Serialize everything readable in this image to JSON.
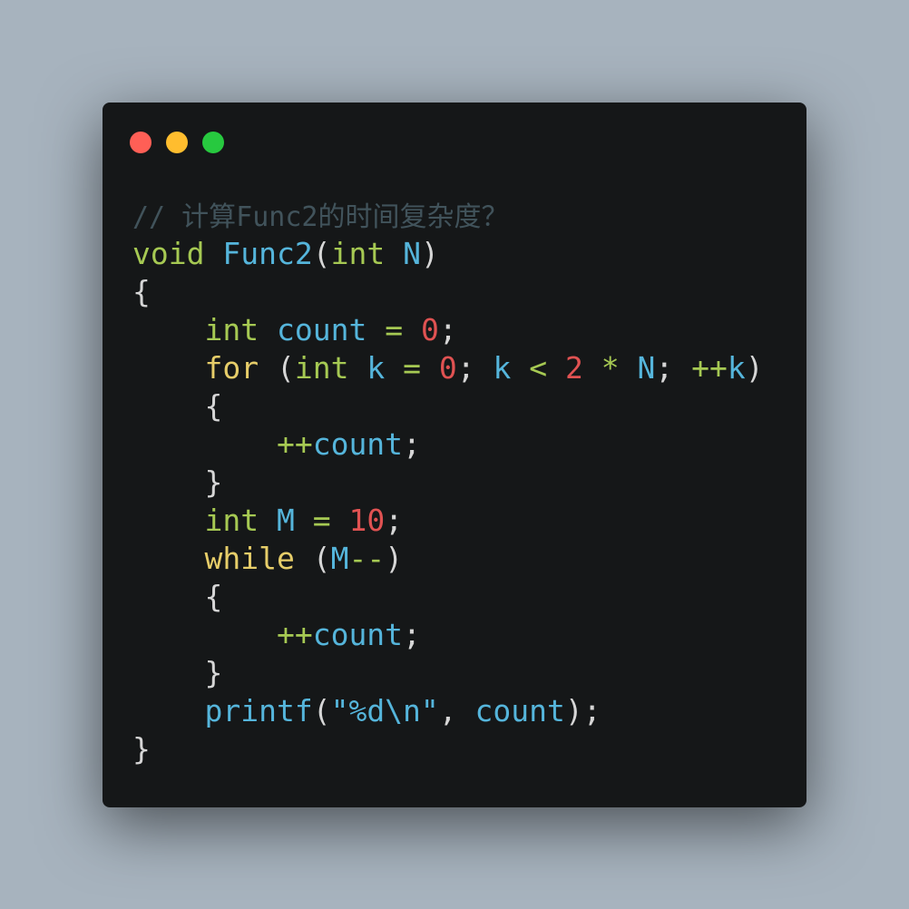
{
  "window_controls": [
    {
      "name": "close",
      "color": "#ff5f56"
    },
    {
      "name": "minimize",
      "color": "#ffbd2e"
    },
    {
      "name": "maximize",
      "color": "#27c93f"
    }
  ],
  "colors": {
    "keyword": "#a6c953",
    "type": "#a6c953",
    "ident": "#55b5db",
    "number": "#e05252",
    "control": "#e6cd69",
    "punct": "#d6d6d6",
    "comment": "#41535b",
    "op": "#a6c953",
    "string": "#55b5db"
  },
  "lines": [
    [
      {
        "t": "// 计算Func2的时间复杂度？",
        "k": "comment"
      }
    ],
    [
      {
        "t": "void",
        "k": "type"
      },
      {
        "t": " ",
        "k": "punct"
      },
      {
        "t": "Func2",
        "k": "ident"
      },
      {
        "t": "(",
        "k": "punct"
      },
      {
        "t": "int",
        "k": "type"
      },
      {
        "t": " ",
        "k": "punct"
      },
      {
        "t": "N",
        "k": "ident"
      },
      {
        "t": ")",
        "k": "punct"
      }
    ],
    [
      {
        "t": "{",
        "k": "punct"
      }
    ],
    [
      {
        "t": "    ",
        "k": "punct"
      },
      {
        "t": "int",
        "k": "type"
      },
      {
        "t": " ",
        "k": "punct"
      },
      {
        "t": "count",
        "k": "ident"
      },
      {
        "t": " ",
        "k": "punct"
      },
      {
        "t": "=",
        "k": "op"
      },
      {
        "t": " ",
        "k": "punct"
      },
      {
        "t": "0",
        "k": "number"
      },
      {
        "t": ";",
        "k": "punct"
      }
    ],
    [
      {
        "t": "    ",
        "k": "punct"
      },
      {
        "t": "for",
        "k": "control"
      },
      {
        "t": " (",
        "k": "punct"
      },
      {
        "t": "int",
        "k": "type"
      },
      {
        "t": " ",
        "k": "punct"
      },
      {
        "t": "k",
        "k": "ident"
      },
      {
        "t": " ",
        "k": "punct"
      },
      {
        "t": "=",
        "k": "op"
      },
      {
        "t": " ",
        "k": "punct"
      },
      {
        "t": "0",
        "k": "number"
      },
      {
        "t": "; ",
        "k": "punct"
      },
      {
        "t": "k",
        "k": "ident"
      },
      {
        "t": " ",
        "k": "punct"
      },
      {
        "t": "<",
        "k": "op"
      },
      {
        "t": " ",
        "k": "punct"
      },
      {
        "t": "2",
        "k": "number"
      },
      {
        "t": " ",
        "k": "punct"
      },
      {
        "t": "*",
        "k": "op"
      },
      {
        "t": " ",
        "k": "punct"
      },
      {
        "t": "N",
        "k": "ident"
      },
      {
        "t": "; ",
        "k": "punct"
      },
      {
        "t": "++",
        "k": "op"
      },
      {
        "t": "k",
        "k": "ident"
      },
      {
        "t": ")",
        "k": "punct"
      }
    ],
    [
      {
        "t": "    {",
        "k": "punct"
      }
    ],
    [
      {
        "t": "        ",
        "k": "punct"
      },
      {
        "t": "++",
        "k": "op"
      },
      {
        "t": "count",
        "k": "ident"
      },
      {
        "t": ";",
        "k": "punct"
      }
    ],
    [
      {
        "t": "    }",
        "k": "punct"
      }
    ],
    [
      {
        "t": "    ",
        "k": "punct"
      },
      {
        "t": "int",
        "k": "type"
      },
      {
        "t": " ",
        "k": "punct"
      },
      {
        "t": "M",
        "k": "ident"
      },
      {
        "t": " ",
        "k": "punct"
      },
      {
        "t": "=",
        "k": "op"
      },
      {
        "t": " ",
        "k": "punct"
      },
      {
        "t": "10",
        "k": "number"
      },
      {
        "t": ";",
        "k": "punct"
      }
    ],
    [
      {
        "t": "    ",
        "k": "punct"
      },
      {
        "t": "while",
        "k": "control"
      },
      {
        "t": " (",
        "k": "punct"
      },
      {
        "t": "M",
        "k": "ident"
      },
      {
        "t": "--",
        "k": "op"
      },
      {
        "t": ")",
        "k": "punct"
      }
    ],
    [
      {
        "t": "    {",
        "k": "punct"
      }
    ],
    [
      {
        "t": "        ",
        "k": "punct"
      },
      {
        "t": "++",
        "k": "op"
      },
      {
        "t": "count",
        "k": "ident"
      },
      {
        "t": ";",
        "k": "punct"
      }
    ],
    [
      {
        "t": "    }",
        "k": "punct"
      }
    ],
    [
      {
        "t": "    ",
        "k": "punct"
      },
      {
        "t": "printf",
        "k": "ident"
      },
      {
        "t": "(",
        "k": "punct"
      },
      {
        "t": "\"%d\\n\"",
        "k": "string"
      },
      {
        "t": ", ",
        "k": "punct"
      },
      {
        "t": "count",
        "k": "ident"
      },
      {
        "t": ");",
        "k": "punct"
      }
    ],
    [
      {
        "t": "}",
        "k": "punct"
      }
    ]
  ]
}
